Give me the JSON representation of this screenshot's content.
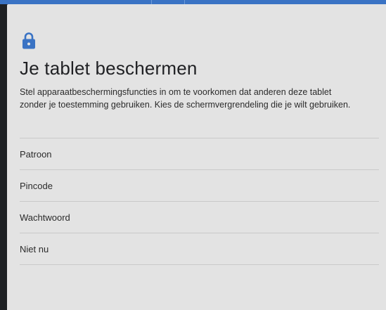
{
  "header": {
    "lock_icon": "lock-icon",
    "title": "Je tablet beschermen",
    "description": "Stel apparaatbeschermingsfuncties in om te voorkomen dat anderen deze tablet zonder je toestemming gebruiken. Kies de schermvergrendeling die je wilt gebruiken."
  },
  "options": [
    {
      "label": "Patroon"
    },
    {
      "label": "Pincode"
    },
    {
      "label": "Wachtwoord"
    },
    {
      "label": "Niet nu"
    }
  ],
  "colors": {
    "accent": "#3a73c4",
    "background": "#e3e3e3",
    "outer": "#1f2124"
  }
}
